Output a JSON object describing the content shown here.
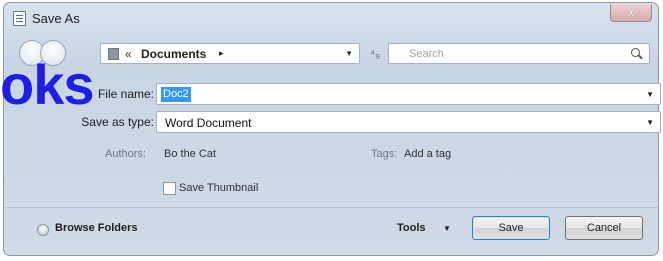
{
  "window": {
    "title": "Save As",
    "close_glyph": "x"
  },
  "nav": {
    "breadcrumb_separator": "«",
    "breadcrumb_folder": "Documents",
    "breadcrumb_arrow": "▸",
    "address_dropdown": "▼",
    "refresh_glyph": "⁴₉",
    "search_placeholder": "Search"
  },
  "form": {
    "file_name_label": "File name:",
    "file_name_value": "Doc2",
    "file_name_dropdown": "▼",
    "save_as_type_label": "Save as type:",
    "save_as_type_value": "Word Document",
    "save_as_type_dropdown": "▼",
    "authors_label": "Authors:",
    "authors_value": "Bo the Cat",
    "tags_label": "Tags:",
    "tags_value": "Add a tag",
    "save_thumbnail_label": "Save Thumbnail",
    "save_thumbnail_checked": false
  },
  "footer": {
    "browse_folders_label": "Browse Folders",
    "tools_label": "Tools",
    "tools_arrow": "▼",
    "save_label": "Save",
    "cancel_label": "Cancel"
  },
  "overlay": {
    "watermark_text": "oks"
  },
  "icons": {
    "app": "document-icon",
    "back": "back-arrow-icon",
    "forward": "forward-arrow-icon",
    "folder": "folder-icon",
    "refresh": "refresh-icon",
    "search": "search-icon",
    "browse": "chevron-expand-icon"
  },
  "colors": {
    "selection": "#3399ff",
    "watermark": "#1e1ee6",
    "window_bg": "#d1dbe7"
  }
}
